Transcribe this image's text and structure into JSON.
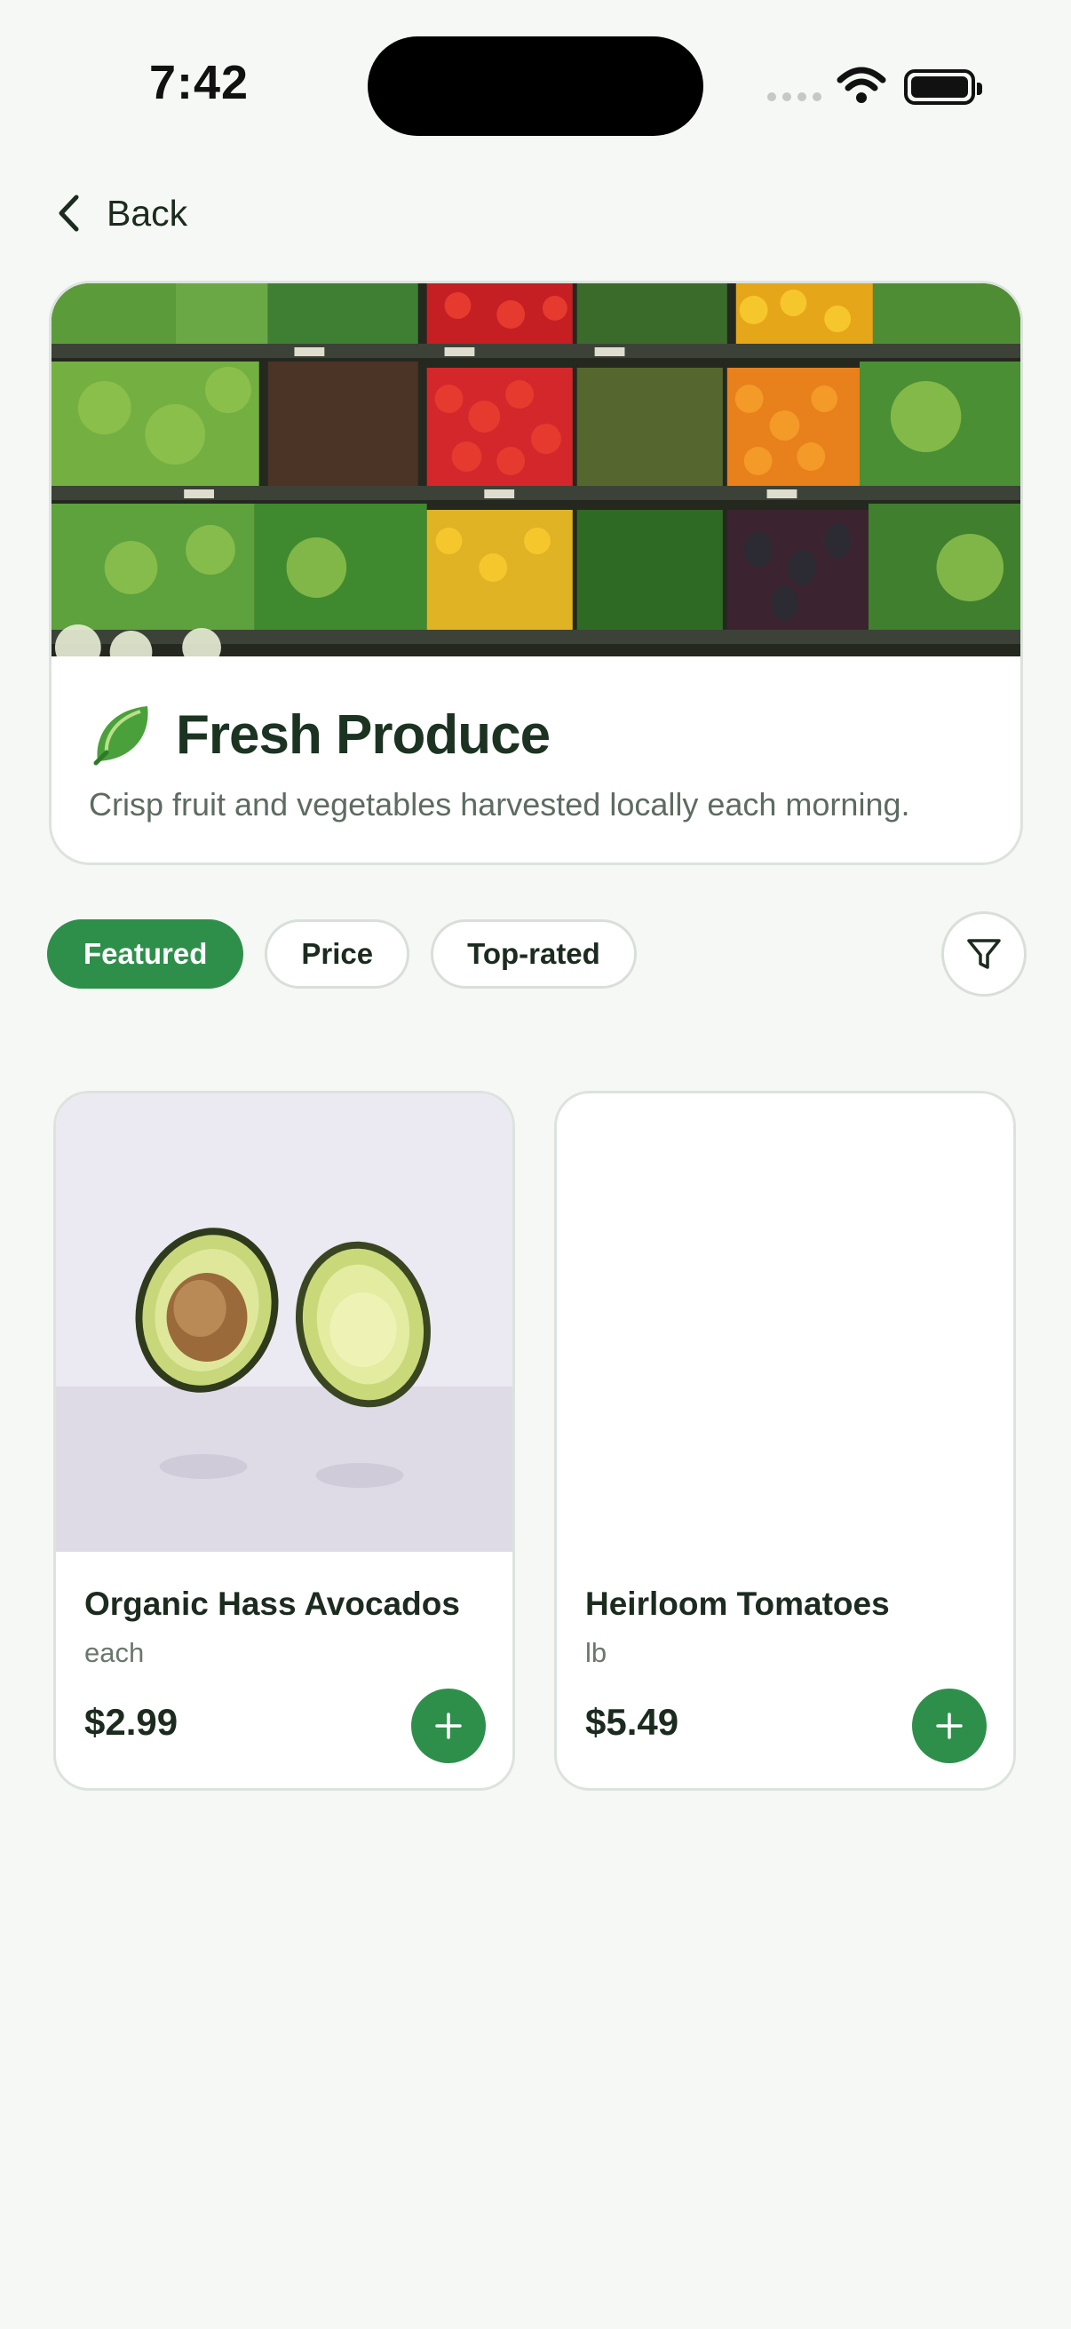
{
  "status_bar": {
    "time": "7:42"
  },
  "nav": {
    "back_label": "Back"
  },
  "category": {
    "title": "Fresh Produce",
    "description": "Crisp fruit and vegetables harvested locally each morning.",
    "icon": "leafy-green-icon"
  },
  "filters": {
    "chips": [
      {
        "label": "Featured",
        "active": true
      },
      {
        "label": "Price",
        "active": false
      },
      {
        "label": "Top-rated",
        "active": false
      }
    ],
    "filter_icon": "filter-icon"
  },
  "products": [
    {
      "name": "Organic Hass Avocados",
      "unit": "each",
      "price": "$2.99"
    },
    {
      "name": "Heirloom Tomatoes",
      "unit": "lb",
      "price": "$5.49"
    }
  ],
  "colors": {
    "accent": "#2e8f4b",
    "background": "#f5f8f4",
    "card_border": "#dce3dd"
  }
}
